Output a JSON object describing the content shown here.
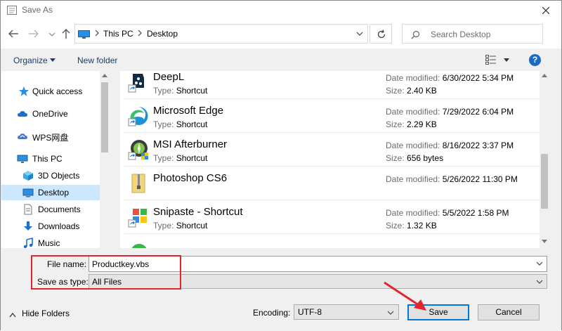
{
  "window": {
    "title": "Save As",
    "close_label": "Close"
  },
  "address": {
    "crumbs": [
      "This PC",
      "Desktop"
    ]
  },
  "search": {
    "placeholder": "Search Desktop"
  },
  "toolbar": {
    "organize": "Organize",
    "new_folder": "New folder",
    "help": "?"
  },
  "sidebar": {
    "items": [
      {
        "label": "Quick access",
        "icon": "star-icon"
      },
      {
        "label": "OneDrive",
        "icon": "cloud-icon"
      },
      {
        "label": "WPS网盘",
        "icon": "wps-cloud-icon"
      },
      {
        "label": "This PC",
        "icon": "pc-icon"
      },
      {
        "label": "3D Objects",
        "icon": "cube-icon"
      },
      {
        "label": "Desktop",
        "icon": "desktop-icon",
        "selected": true
      },
      {
        "label": "Documents",
        "icon": "document-icon"
      },
      {
        "label": "Downloads",
        "icon": "download-icon"
      },
      {
        "label": "Music",
        "icon": "music-icon"
      }
    ]
  },
  "files": {
    "type_prefix": "Type:",
    "modified_prefix": "Date modified:",
    "size_prefix": "Size:",
    "rows": [
      {
        "name": "DeepL",
        "type": "Shortcut",
        "modified": "6/30/2022 5:34 PM",
        "size": "2.40 KB"
      },
      {
        "name": "Microsoft Edge",
        "type": "Shortcut",
        "modified": "7/29/2022 6:04 PM",
        "size": "2.29 KB"
      },
      {
        "name": "MSI Afterburner",
        "type": "Shortcut",
        "modified": "8/16/2022 3:37 PM",
        "size": "656 bytes"
      },
      {
        "name": "Photoshop CS6",
        "type": "",
        "modified": "5/26/2022 11:30 PM",
        "size": ""
      },
      {
        "name": "Snipaste - Shortcut",
        "type": "Shortcut",
        "modified": "5/5/2022 1:58 PM",
        "size": "1.32 KB"
      }
    ]
  },
  "form": {
    "file_name_label": "File name:",
    "file_name_value": "Productkey.vbs",
    "save_as_type_label": "Save as type:",
    "save_as_type_value": "All Files",
    "encoding_label": "Encoding:",
    "encoding_value": "UTF-8"
  },
  "footer": {
    "hide_folders": "Hide Folders",
    "save": "Save",
    "cancel": "Cancel"
  },
  "colors": {
    "accent": "#0078d7",
    "highlight": "#e3232d",
    "selection": "#cce8ff"
  }
}
